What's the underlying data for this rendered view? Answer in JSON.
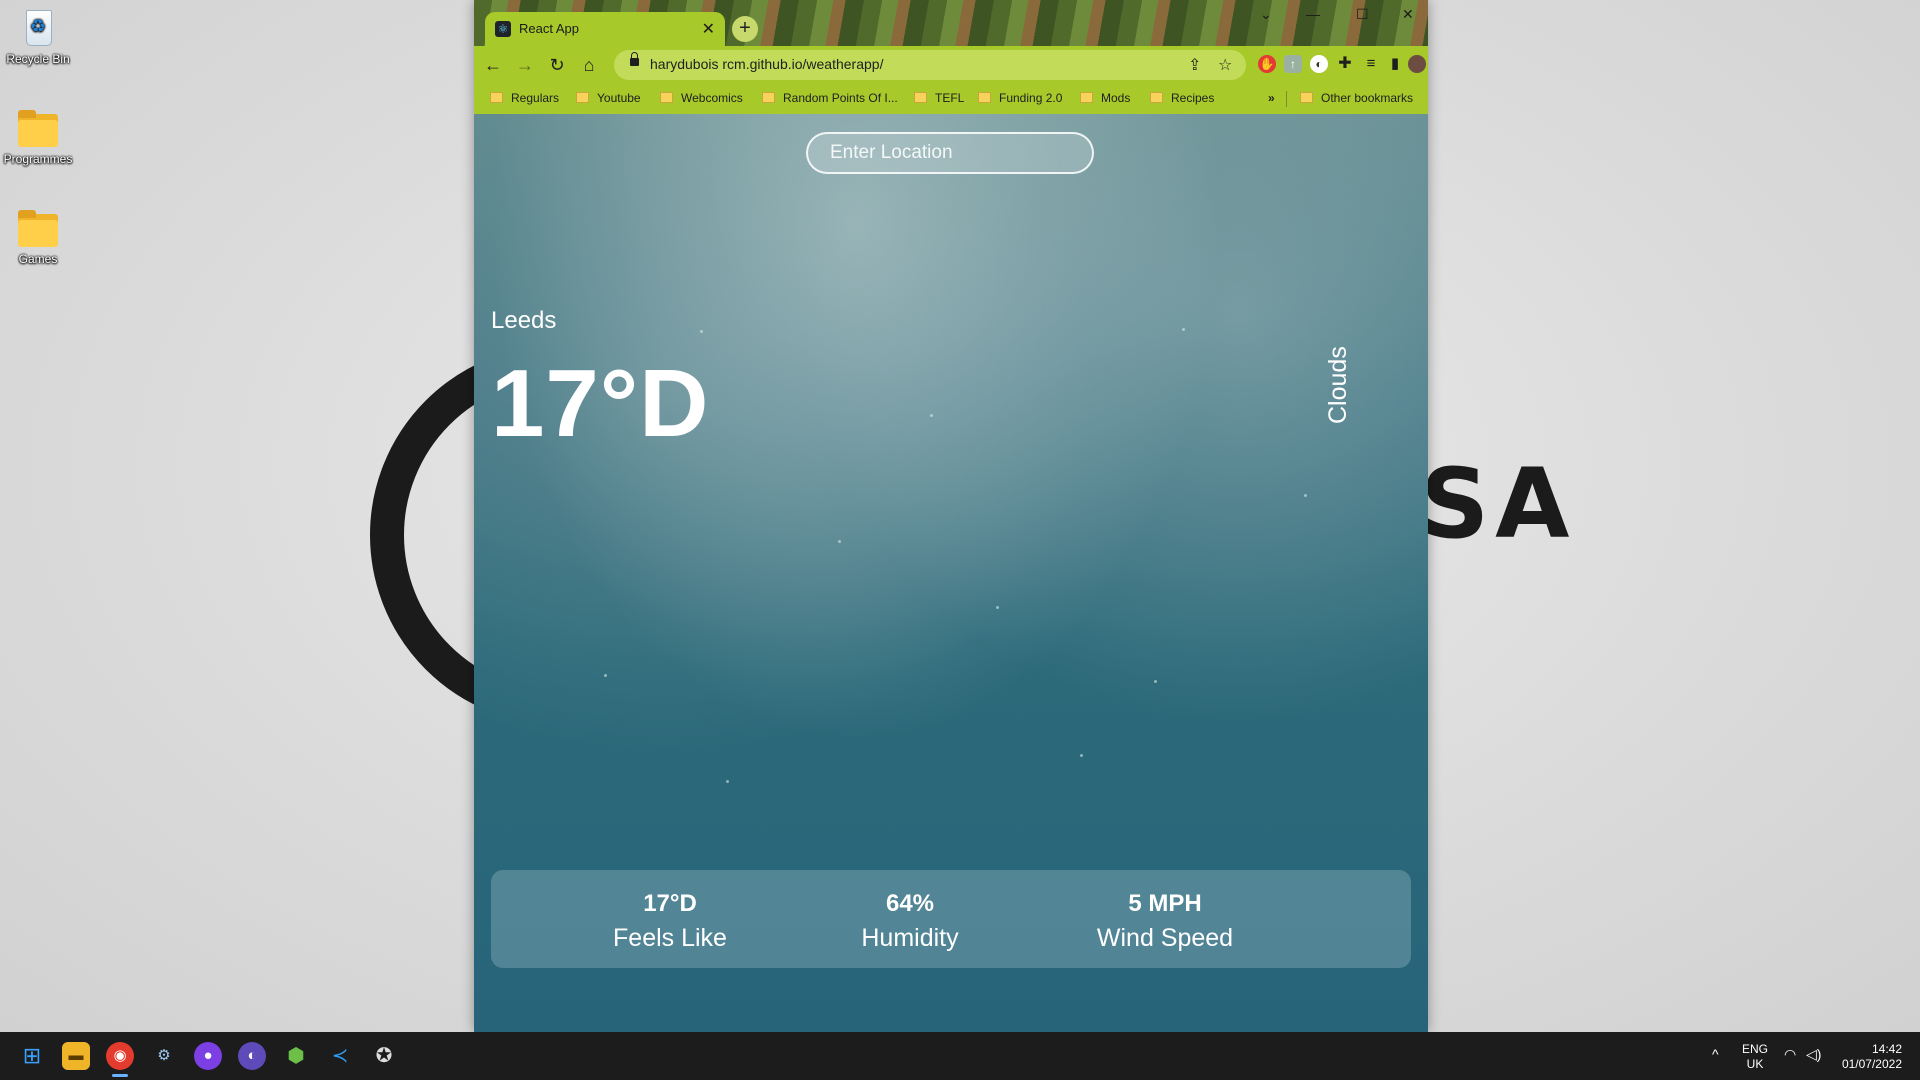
{
  "desktop": {
    "wallpaper_text": "SA",
    "icons": [
      {
        "label": "Recycle Bin"
      },
      {
        "label": "Programmes"
      },
      {
        "label": "Games"
      }
    ]
  },
  "browser": {
    "tab_title": "React App",
    "url": "harydubois rcm.github.io/weatherapp/",
    "bookmarks": [
      "Regulars",
      "Youtube",
      "Webcomics",
      "Random Points Of I...",
      "TEFL",
      "Funding 2.0",
      "Mods",
      "Recipes"
    ],
    "bookmarks_overflow": "»",
    "other_bookmarks": "Other bookmarks"
  },
  "weather": {
    "search_placeholder": "Enter Location",
    "city": "Leeds",
    "temperature": "17°D",
    "description": "Clouds",
    "stats": [
      {
        "value": "17°D",
        "label": "Feels Like"
      },
      {
        "value": "64%",
        "label": "Humidity"
      },
      {
        "value": "5 MPH",
        "label": "Wind Speed"
      }
    ]
  },
  "taskbar": {
    "language": "ENG",
    "region": "UK",
    "time": "14:42",
    "date": "01/07/2022"
  },
  "colors": {
    "browser_theme": "#a7c92a",
    "page_background": "#2c6a7a",
    "taskbar": "#1c1c1c"
  }
}
